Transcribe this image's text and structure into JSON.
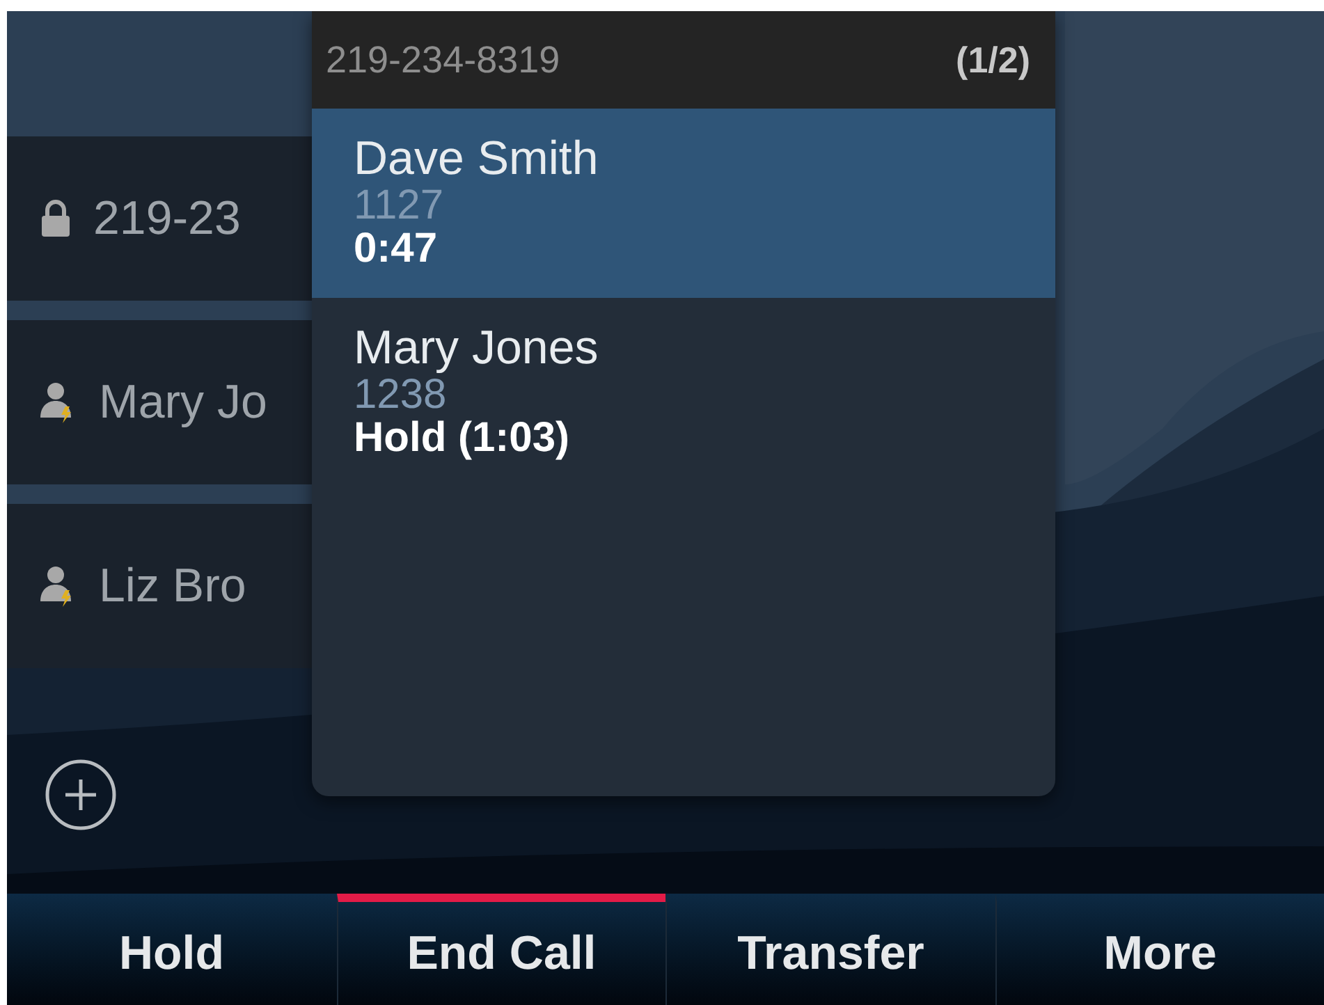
{
  "lines": [
    {
      "kind": "secure",
      "label": "219-23"
    },
    {
      "kind": "contact",
      "label": "Mary Jo"
    },
    {
      "kind": "contact",
      "label": "Liz Bro"
    }
  ],
  "popup": {
    "number": "219-234-8319",
    "count": "(1/2)",
    "calls": [
      {
        "name": "Dave Smith",
        "extension": "1127",
        "status": "0:47",
        "selected": true
      },
      {
        "name": "Mary Jones",
        "extension": "1238",
        "status": "Hold (1:03)",
        "selected": false
      }
    ]
  },
  "softkeys": [
    {
      "label": "Hold",
      "selected": false
    },
    {
      "label": "End Call",
      "selected": true
    },
    {
      "label": "Transfer",
      "selected": false
    },
    {
      "label": "More",
      "selected": false
    }
  ]
}
